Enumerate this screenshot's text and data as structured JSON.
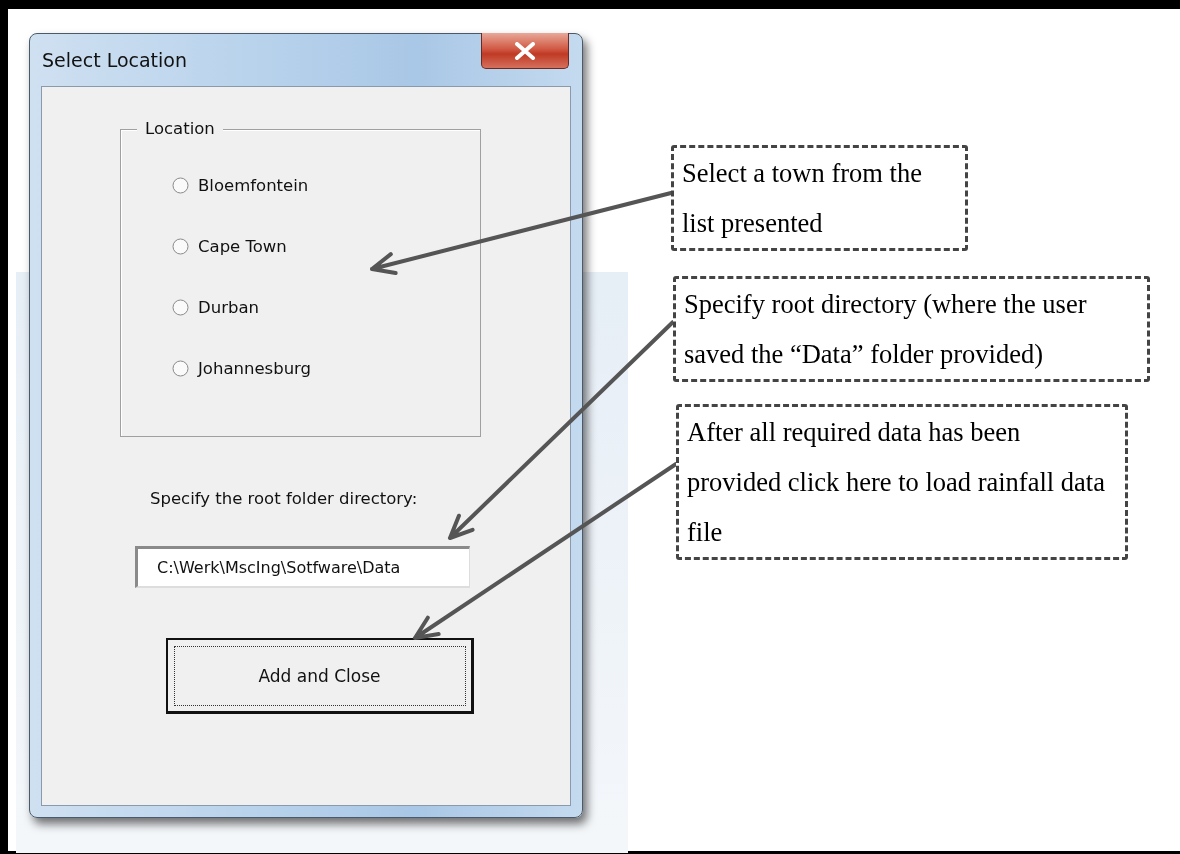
{
  "window": {
    "title": "Select Location"
  },
  "location_group": {
    "label": "Location",
    "options": [
      {
        "label": "Bloemfontein",
        "selected": false
      },
      {
        "label": "Cape Town",
        "selected": false
      },
      {
        "label": "Durban",
        "selected": false
      },
      {
        "label": "Johannesburg",
        "selected": false
      }
    ]
  },
  "root_folder": {
    "label": "Specify the root folder directory:",
    "value": "C:\\Werk\\MscIng\\Sotfware\\Data"
  },
  "buttons": [
    {
      "label": "Add and Close"
    }
  ],
  "annotations": [
    {
      "text": "Select a town from the list presented"
    },
    {
      "text": "Specify root directory (where the user saved the “Data” folder provided)"
    },
    {
      "text": "After all required data has been provided click here to load rainfall data file"
    }
  ]
}
